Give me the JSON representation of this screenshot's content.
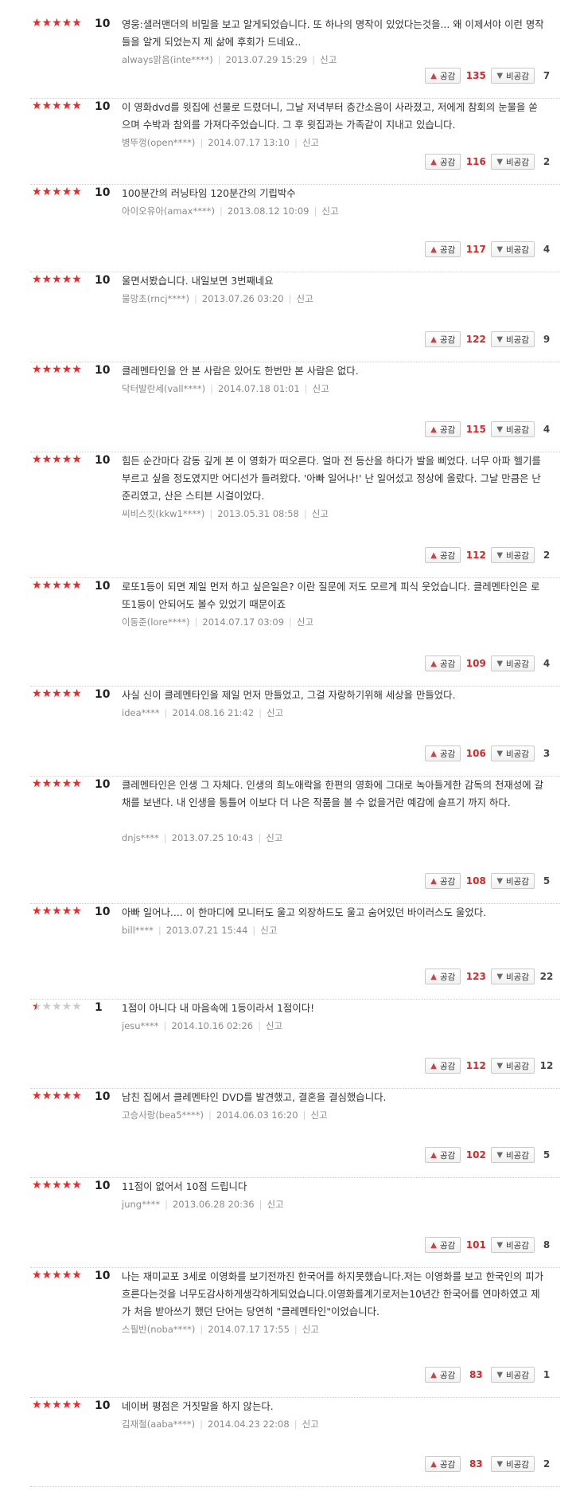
{
  "labels": {
    "like": "공감",
    "dislike": "비공감",
    "report": "신고"
  },
  "colors": {
    "star_on": "#ee2828",
    "star_off": "#cccccc",
    "like_count": "#e02424"
  },
  "reviews": [
    {
      "stars": 5,
      "score": "10",
      "text": "영웅:샐러맨더의 비밀을 보고 알게되었습니다. 또 하나의 명작이 있었다는것을... 왜 이제서야 이런 명작들을 알게 되었는지 제 삶에 후회가 드네요..",
      "author": "always맑음(inte****)",
      "date": "2013.07.29 15:29",
      "likes": "135",
      "dislikes": "7"
    },
    {
      "stars": 5,
      "score": "10",
      "text": "이 영화dvd를 윗집에 선물로 드렸더니, 그날 저녁부터 층간소음이 사라졌고, 저에게 참회의 눈물을 쏟으며 수박과 참외를 가져다주었습니다. 그 후 윗집과는 가족같이 지내고 있습니다.",
      "author": "병뚜껑(open****)",
      "date": "2014.07.17 13:10",
      "likes": "116",
      "dislikes": "2"
    },
    {
      "stars": 5,
      "score": "10",
      "text": "100분간의 러닝타임 120분간의 기립박수",
      "author": "아이오유아(amax****)",
      "date": "2013.08.12 10:09",
      "likes": "117",
      "dislikes": "4"
    },
    {
      "stars": 5,
      "score": "10",
      "text": "울면서봤습니다. 내일보면 3번째네요",
      "author": "물망초(rncj****)",
      "date": "2013.07.26 03:20",
      "likes": "122",
      "dislikes": "9"
    },
    {
      "stars": 5,
      "score": "10",
      "text": "클레멘타인을 안 본 사람은 있어도 한번만 본 사람은 없다.",
      "author": "닥터발란세(vall****)",
      "date": "2014.07.18 01:01",
      "likes": "115",
      "dislikes": "4"
    },
    {
      "stars": 5,
      "score": "10",
      "text": "힘든 순간마다 감동 깊게 본 이 영화가 떠오른다. 얼마 전 등산을 하다가 발을 삐었다. 너무 아파 헬기를 부르고 싶을 정도였지만 어디선가 들려왔다. '아빠 일어나!' 난 일어섰고 정상에 올랐다. 그날 만큼은 난 준리였고, 산은 스티븐 시걸이었다.",
      "author": "씨비스킷(kkw1****)",
      "date": "2013.05.31 08:58",
      "likes": "112",
      "dislikes": "2"
    },
    {
      "stars": 5,
      "score": "10",
      "text": "로또1등이 되면 제일 먼저 하고 싶은일은? 이란 질문에 저도 모르게 피식 웃었습니다. 클레멘타인은 로또1등이 안되어도 볼수 있었기 때문이죠",
      "author": "이동준(lore****)",
      "date": "2014.07.17 03:09",
      "likes": "109",
      "dislikes": "4"
    },
    {
      "stars": 5,
      "score": "10",
      "text": "사실 신이 클레멘타인을 제일 먼저 만들었고, 그걸 자랑하기위해 세상을 만들었다.",
      "author": "idea****",
      "date": "2014.08.16 21:42",
      "likes": "106",
      "dislikes": "3"
    },
    {
      "stars": 5,
      "score": "10",
      "text": "클레멘타인은 인생 그 자체다. 인생의 희노애락을 한편의 영화에 그대로 녹아들게한 감독의 천재성에 갈채를 보낸다. 내 인생을 통틀어 이보다 더 나은 작품을 볼 수 없을거란 예감에 슬프기 까지 하다.",
      "author": "dnjs****",
      "date": "2013.07.25 10:43",
      "likes": "108",
      "dislikes": "5"
    },
    {
      "stars": 5,
      "score": "10",
      "text": "아빠 일어나.... 이 한마디에 모니터도 울고 외장하드도 울고 숨어있던 바이러스도 울었다.",
      "author": "bill****",
      "date": "2013.07.21 15:44",
      "likes": "123",
      "dislikes": "22"
    },
    {
      "stars": 0.5,
      "score": "1",
      "text": "1점이 아니다 내 마음속에 1등이라서 1점이다!",
      "author": "jesu****",
      "date": "2014.10.16 02:26",
      "likes": "112",
      "dislikes": "12"
    },
    {
      "stars": 5,
      "score": "10",
      "text": "남친 집에서 클레멘타인 DVD를 발견했고, 결혼을 결심했습니다.",
      "author": "고승사랑(bea5****)",
      "date": "2014.06.03 16:20",
      "likes": "102",
      "dislikes": "5"
    },
    {
      "stars": 5,
      "score": "10",
      "text": "11점이 없어서 10점 드립니다",
      "author": "jung****",
      "date": "2013.06.28 20:36",
      "likes": "101",
      "dislikes": "8"
    },
    {
      "stars": 5,
      "score": "10",
      "text": "나는 재미교포 3세로 이영화를 보기전까진 한국어를 하지못했습니다.저는 이영화를 보고 한국인의 피가흐른다는것을 너무도감사하게생각하게되었습니다.이영화를계기로저는10년간 한국어를 연마하였고 제가 처음 받아쓰기 했던 단어는 당연히 \"클레멘타인\"이었습니다.",
      "author": "스필반(noba****)",
      "date": "2014.07.17 17:55",
      "likes": "83",
      "dislikes": "1"
    },
    {
      "stars": 5,
      "score": "10",
      "text": "네이버 평점은 거짓말을 하지 않는다.",
      "author": "김재철(aaba****)",
      "date": "2014.04.23 22:08",
      "likes": "83",
      "dislikes": "2"
    }
  ]
}
